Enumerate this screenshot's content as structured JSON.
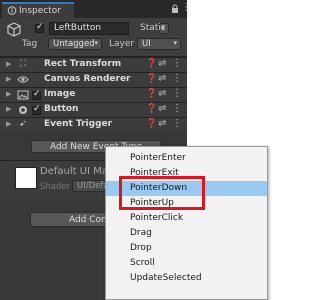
{
  "inspector": {
    "tab_label": "Inspector",
    "object_name": "LeftButton",
    "static_label": "Static",
    "tag_label": "Tag",
    "tag_value": "Untagged",
    "layer_label": "Layer",
    "layer_value": "UI"
  },
  "components": [
    {
      "name": "Rect Transform",
      "icon": "rect-transform-icon",
      "has_checkbox": false
    },
    {
      "name": "Canvas Renderer",
      "icon": "eye-icon",
      "has_checkbox": false
    },
    {
      "name": "Image",
      "icon": "image-icon",
      "has_checkbox": true
    },
    {
      "name": "Button",
      "icon": "button-icon",
      "has_checkbox": true
    },
    {
      "name": "Event Trigger",
      "icon": "event-trigger-icon",
      "has_checkbox": false
    }
  ],
  "event_trigger": {
    "add_event_label": "Add New Event Type"
  },
  "material": {
    "name": "Default UI Mate",
    "shader_label": "Shader",
    "shader_value": "UI/Defa"
  },
  "add_component_label": "Add Compo",
  "menu": {
    "items": [
      "PointerEnter",
      "PointerExit",
      "PointerDown",
      "PointerUp",
      "PointerClick",
      "Drag",
      "Drop",
      "Scroll",
      "UpdateSelected"
    ],
    "selected_index": 2
  },
  "colors": {
    "panel_bg": "#383838",
    "tab_accent": "#3a79bb",
    "menu_selected": "#99c9ef",
    "highlight_red": "#e0141e"
  }
}
